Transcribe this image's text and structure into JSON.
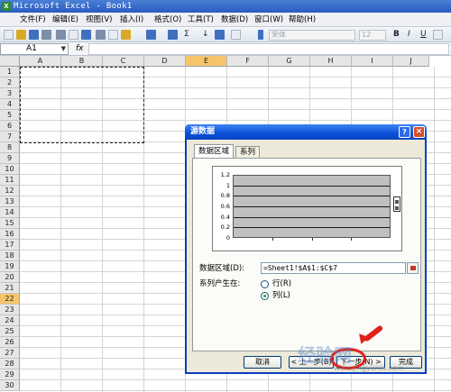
{
  "window": {
    "title": "Microsoft Excel - Book1",
    "app_icon": "X"
  },
  "menu": [
    "文件(F)",
    "编辑(E)",
    "视图(V)",
    "插入(I)",
    "格式(O)",
    "工具(T)",
    "数据(D)",
    "窗口(W)",
    "帮助(H)"
  ],
  "toolbar": {
    "font_name": "宋体",
    "font_size": "12",
    "bold": "B",
    "italic": "I",
    "underline": "U",
    "sigma": "Σ",
    "sort_label": "↓"
  },
  "formula_bar": {
    "name_box": "A1",
    "fx": "fx",
    "value": ""
  },
  "sheet": {
    "columns": [
      "A",
      "B",
      "C",
      "D",
      "E",
      "F",
      "G",
      "H",
      "I",
      "J"
    ],
    "selected_column": "E",
    "rows": [
      "1",
      "2",
      "3",
      "4",
      "5",
      "6",
      "7",
      "8",
      "9",
      "10",
      "11",
      "12",
      "13",
      "14",
      "15",
      "16",
      "17",
      "18",
      "19",
      "20",
      "21",
      "22",
      "23",
      "24",
      "25",
      "26",
      "27",
      "28",
      "29",
      "30"
    ],
    "selected_row": "22"
  },
  "dialog": {
    "title": "源数据",
    "help": "?",
    "close": "×",
    "tabs": [
      "数据区域",
      "系列"
    ],
    "active_tab": "数据区域",
    "data_range_label": "数据区域(D):",
    "data_range_value": "=Sheet1!$A$1:$C$7",
    "series_in_label": "系列产生在:",
    "options": [
      {
        "label": "行(R)",
        "selected": false
      },
      {
        "label": "列(L)",
        "selected": true
      }
    ],
    "buttons": {
      "cancel": "取消",
      "back": "< 上一步(B)",
      "next": "下一步(N) >",
      "finish": "完成"
    }
  },
  "chart_data": {
    "type": "bar",
    "y_ticks": [
      "1.2",
      "1",
      "0.8",
      "0.6",
      "0.4",
      "0.2",
      "0"
    ],
    "ylim": [
      0,
      1.2
    ],
    "categories": [],
    "values": []
  },
  "watermark": {
    "text": "经验网",
    "url": "www.jingyanla.com"
  }
}
